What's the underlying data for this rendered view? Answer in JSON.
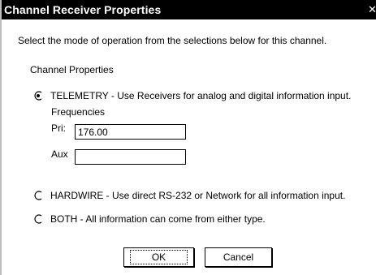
{
  "window": {
    "title": "Channel Receiver Properties",
    "close_glyph": "✕"
  },
  "intro_text": "Select the mode of operation from the selections below for this channel.",
  "group_label": "Channel Properties",
  "options": {
    "telemetry": {
      "label": "TELEMETRY - Use Receivers for analog and digital information input.",
      "selected": true
    },
    "hardwire": {
      "label": "HARDWIRE - Use direct RS-232 or Network for all information input.",
      "selected": false
    },
    "both": {
      "label": "BOTH - All information can come from either type.",
      "selected": false
    }
  },
  "frequencies": {
    "label": "Frequencies",
    "pri_label": "Pri:",
    "pri_value": "176.00",
    "aux_label": "Aux",
    "aux_value": ""
  },
  "buttons": {
    "ok": "OK",
    "cancel": "Cancel"
  }
}
